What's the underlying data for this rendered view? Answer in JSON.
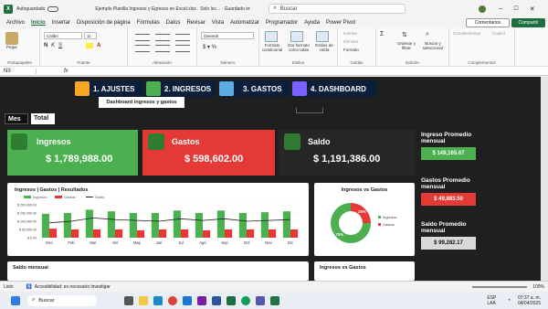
{
  "title_bar": {
    "autosave": "Autoguardado",
    "doc_title": "Ejemplo Planilla Ingresos y Egresos en Excel.xlsx · Solo lec... · Guardado en Este PC",
    "search_placeholder": "Buscar"
  },
  "menu": [
    "Archivo",
    "Inicio",
    "Insertar",
    "Disposición de página",
    "Fórmulas",
    "Datos",
    "Revisar",
    "Vista",
    "Automatizar",
    "Programador",
    "Ayuda",
    "Power Pivot"
  ],
  "menu_active": "Inicio",
  "menu_right": {
    "comments": "Comentarios",
    "share": "Compartir"
  },
  "ribbon": {
    "paste": "Pegar",
    "font_name": "Calibri",
    "font_size": "11",
    "number_format": "General",
    "cond_format": "Formato condicional",
    "table_format": "Dar formato como tabla",
    "cell_styles": "Estilos de celda",
    "insert": "Insertar",
    "delete": "Eliminar",
    "format": "Formato",
    "sort": "Ordenar y filtrar",
    "find": "Buscar y seleccionar",
    "addins": "Complementos",
    "copilot": "Copilot",
    "groups": {
      "clipboard": "Portapapeles",
      "font": "Fuente",
      "align": "Alineación",
      "number": "Número",
      "styles": "Estilos",
      "cells": "Celdas",
      "edit": "Edición",
      "addins": "Complementos"
    }
  },
  "formula_bar": {
    "cell_ref": "N3",
    "fx": "fx"
  },
  "nav_tabs": [
    {
      "label": "1. AJUSTES"
    },
    {
      "label": "2. INGRESOS"
    },
    {
      "label": "3. GASTOS"
    },
    {
      "label": "4. DASHBOARD"
    }
  ],
  "dashboard_title": "Dashboard ingresos y gastos",
  "filters": {
    "mes": "Mes",
    "total": "Total"
  },
  "cards": {
    "ingresos": {
      "label": "Ingresos",
      "value": "$ 1,789,988.00"
    },
    "gastos": {
      "label": "Gastos",
      "value": "$ 598,602.00"
    },
    "saldo": {
      "label": "Saldo",
      "value": "$ 1,191,386.00"
    }
  },
  "side": {
    "ingreso_prom": {
      "label": "Ingreso Promedio mensual",
      "value": "$ 149,165.67"
    },
    "gasto_prom": {
      "label": "Gastos Promedio mensual",
      "value": "$ 49,883.50"
    },
    "saldo_prom": {
      "label": "Saldo Promedio mensual",
      "value": "$ 99,282.17"
    }
  },
  "colors": {
    "green": "#4caf50",
    "red": "#e53935",
    "dark": "#262626",
    "navy": "#0b1e3a"
  },
  "chart_data": [
    {
      "type": "bar",
      "title": "Ingresos | Gastos | Resultados",
      "categories": [
        "Ene",
        "Feb",
        "Mar",
        "Abr",
        "May",
        "Jun",
        "Jul",
        "Ago",
        "Sep",
        "Oct",
        "Nov",
        "Dic"
      ],
      "series": [
        {
          "name": "Ingresos",
          "values": [
            145000,
            150000,
            170000,
            160000,
            150000,
            150000,
            165000,
            150000,
            165000,
            150000,
            155000,
            160000
          ]
        },
        {
          "name": "Gastos",
          "values": [
            55000,
            50000,
            50000,
            50000,
            45000,
            50000,
            50000,
            45000,
            50000,
            50000,
            50000,
            50000
          ]
        },
        {
          "name": "Saldo",
          "values": [
            90000,
            100000,
            120000,
            110000,
            105000,
            100000,
            115000,
            105000,
            115000,
            100000,
            105000,
            110000
          ]
        }
      ],
      "yticks": [
        "$ 200,000.00",
        "$ 150,000.00",
        "$ 100,000.00",
        "$ 50,000.00",
        "$ 0.00"
      ],
      "ylim": [
        0,
        200000
      ]
    },
    {
      "type": "pie",
      "title": "Ingresos vs Gastos",
      "categories": [
        "Ingresos",
        "Gastos"
      ],
      "values": [
        75,
        25
      ],
      "labels": [
        "75%",
        "25%"
      ]
    }
  ],
  "lower_titles": {
    "saldo": "Saldo mensual",
    "ing_gas": "Ingresos vs Gastos"
  },
  "status": {
    "left": "Listo",
    "access": "Accesibilidad: es necesario investigar",
    "zoom": "100%"
  },
  "taskbar": {
    "search": "Buscar",
    "time": "07:37 a. m.",
    "date": "04/04/2025",
    "lang": "ESP LAA"
  }
}
